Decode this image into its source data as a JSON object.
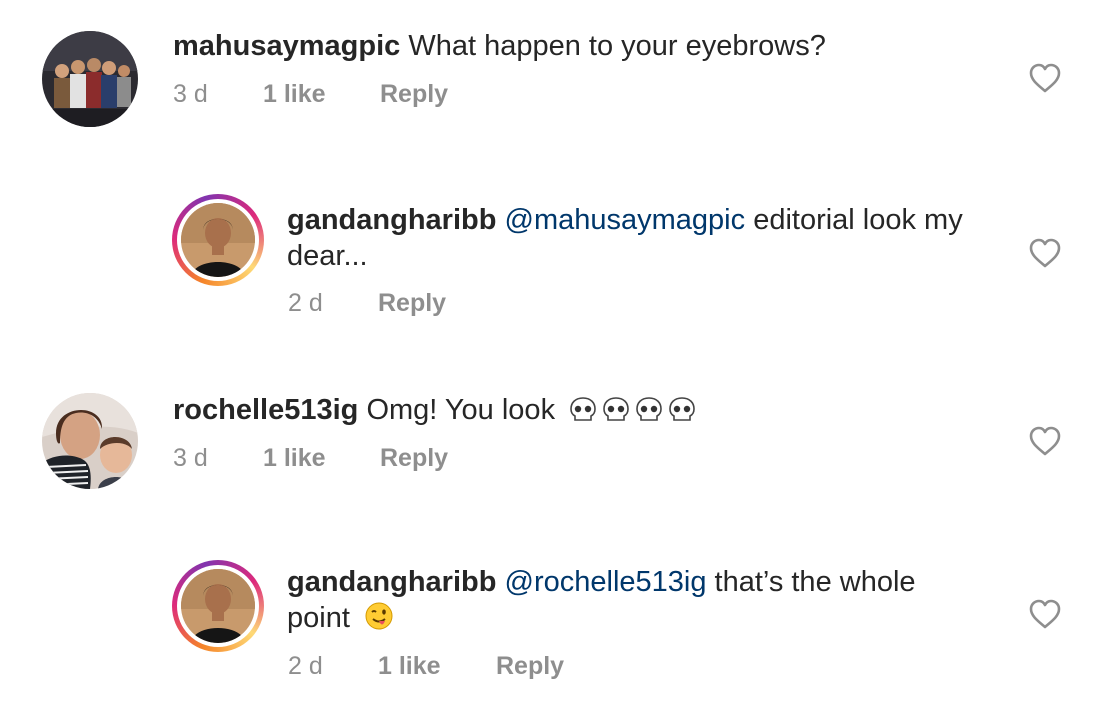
{
  "comments": [
    {
      "username": "mahusaymagpic",
      "text": "What happen to your eyebrows?",
      "time": "3 d",
      "likes": "1 like",
      "reply": "Reply"
    },
    {
      "username": "gandangharibb",
      "mention": "@mahusaymagpic",
      "text_line1": "editorial look my",
      "text_line2": "dear...",
      "time": "2 d",
      "reply": "Reply"
    },
    {
      "username": "rochelle513ig",
      "text": "Omg! You look",
      "emoji": "skull-emoji x4",
      "time": "3 d",
      "likes": "1 like",
      "reply": "Reply"
    },
    {
      "username": "gandangharibb",
      "mention": "@rochelle513ig",
      "text_line1": "that’s the whole",
      "text_line2": "point",
      "emoji": "winking-face-tongue-emoji",
      "time": "2 d",
      "likes": "1 like",
      "reply": "Reply"
    }
  ],
  "icons": {
    "like": "heart-outline-icon"
  },
  "colors": {
    "username": "#262626",
    "mention": "#00376b",
    "meta": "#8e8e8e",
    "story_ring": [
      "#f58529",
      "#dd2a7b",
      "#8134af"
    ]
  }
}
